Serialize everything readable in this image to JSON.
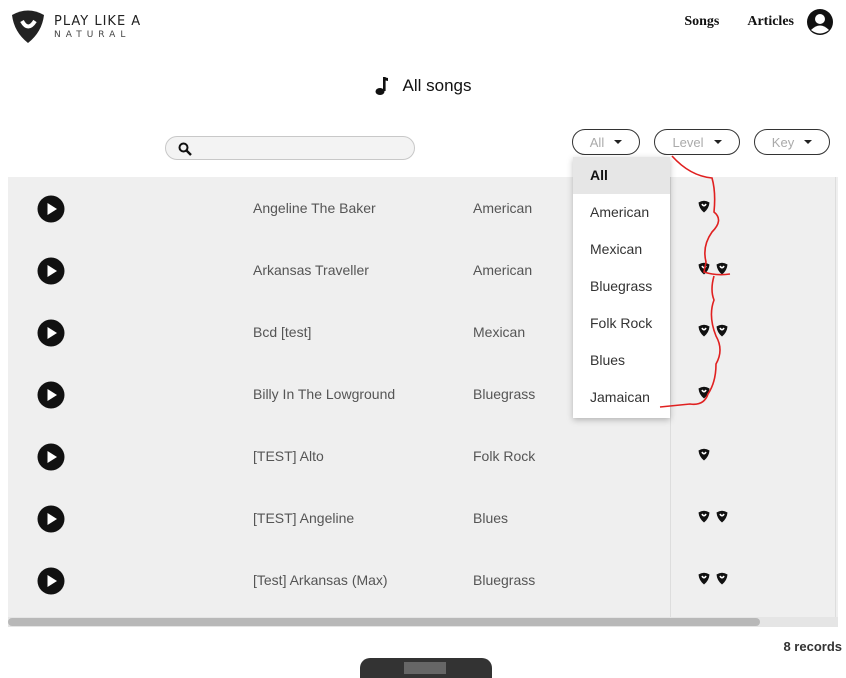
{
  "header": {
    "logo_line1": "PLAY LIKE A",
    "logo_line2": "NATURAL",
    "nav": [
      "Songs",
      "Articles"
    ]
  },
  "page_title": "All songs",
  "search": {
    "placeholder": "",
    "value": ""
  },
  "filters": {
    "category": "All",
    "level": "Level",
    "key": "Key"
  },
  "dropdown": {
    "options": [
      "All",
      "American",
      "Mexican",
      "Bluegrass",
      "Folk Rock",
      "Blues",
      "Jamaican"
    ],
    "selected": "All"
  },
  "songs": [
    {
      "title": "Angeline The Baker",
      "genre": "American",
      "level": 1
    },
    {
      "title": "Arkansas Traveller",
      "genre": "American",
      "level": 2
    },
    {
      "title": "Bcd [test]",
      "genre": "Mexican",
      "level": 2
    },
    {
      "title": "Billy In The Lowground",
      "genre": "Bluegrass",
      "level": 1
    },
    {
      "title": "[TEST] Alto",
      "genre": "Folk Rock",
      "level": 1
    },
    {
      "title": "[TEST] Angeline",
      "genre": "Blues",
      "level": 2
    },
    {
      "title": "[Test] Arkansas (Max)",
      "genre": "Bluegrass",
      "level": 2
    }
  ],
  "records_label": "8 records",
  "colors": {
    "annotation": "#e02020",
    "table_bg": "#efefef"
  }
}
